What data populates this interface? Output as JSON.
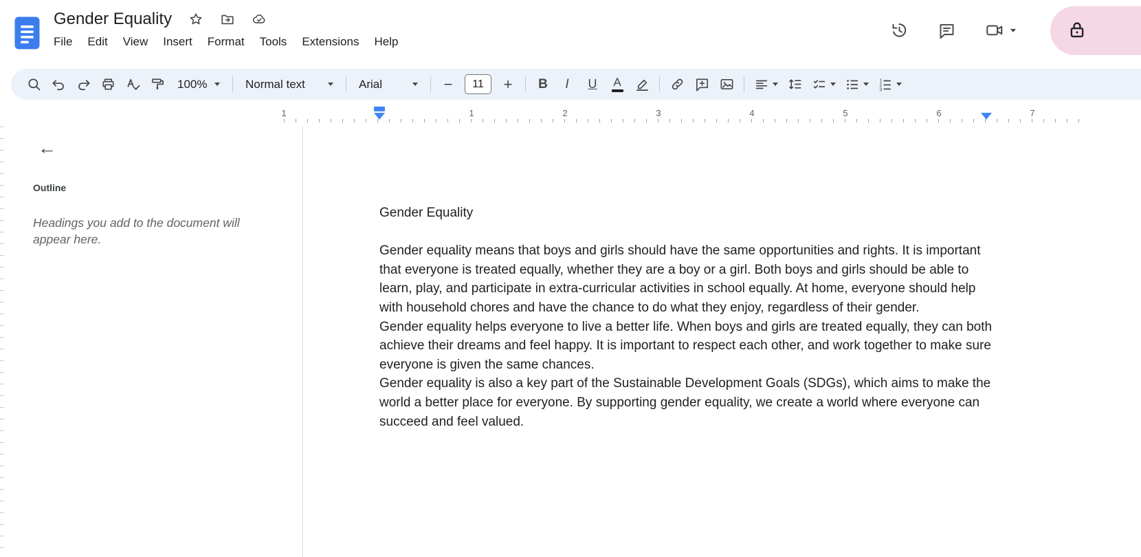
{
  "header": {
    "doc_title": "Gender Equality",
    "menus": [
      "File",
      "Edit",
      "View",
      "Insert",
      "Format",
      "Tools",
      "Extensions",
      "Help"
    ]
  },
  "toolbar": {
    "zoom": "100%",
    "paragraph_style": "Normal text",
    "font": "Arial",
    "font_size": "11",
    "bold_label": "B",
    "italic_label": "I",
    "underline_label": "U",
    "text_color_label": "A",
    "minus_label": "−",
    "plus_label": "+"
  },
  "ruler": {
    "numbers": [
      "1",
      "1",
      "2",
      "3",
      "4",
      "5",
      "6",
      "7"
    ]
  },
  "outline_panel": {
    "back_glyph": "←",
    "title": "Outline",
    "empty_hint": "Headings you add to the document will appear here."
  },
  "document": {
    "title": "Gender Equality",
    "paragraphs": [
      "Gender equality means that boys and girls should have the same opportunities and rights. It is important that everyone is treated equally, whether they are a boy or a girl. Both boys and girls should be able to learn, play, and participate in extra-curricular activities in school equally. At home, everyone should help with household chores and have the chance to do what they enjoy, regardless of their gender.",
      "Gender equality helps everyone to live a better life. When boys and girls are treated equally, they can both achieve their dreams and feel happy. It is important to respect each other, and work together to make sure everyone is given the same chances.",
      "Gender equality is also a key part of the Sustainable Development Goals (SDGs), which aims to make the world a better place for everyone. By supporting gender equality, we create a world where everyone can succeed and feel valued."
    ]
  },
  "icons": {
    "docs_logo": "blue-document-with-white-lines",
    "star": "star-outline",
    "move_folder": "folder-with-arrow",
    "cloud_status": "cloud-with-check",
    "version_history": "clock-with-arrow",
    "open_comments": "speech-bubble",
    "meet_video": "video-camera",
    "share_lock": "padlock",
    "search": "magnifier",
    "undo": "curved-arrow-left",
    "redo": "curved-arrow-right",
    "print": "printer",
    "spellcheck": "a-with-check",
    "paint_format": "paint-roller",
    "highlight": "marker-pen",
    "insert_link": "chain-links",
    "add_comment": "speech-bubble-plus",
    "insert_image": "picture-with-mountain",
    "align": "align-left-lines",
    "line_spacing": "vertical-arrows-with-lines",
    "checklist": "checks-with-lines",
    "bulleted_list": "dots-with-lines",
    "numbered_list": "numbers-with-lines"
  },
  "colors": {
    "toolbar_bg": "#edf2fa",
    "logo_blue": "#3b7ded",
    "icon_gray": "#444746",
    "ruler_marker_blue": "#4285f4",
    "share_pill_pink": "#f5d7e6",
    "hint_gray": "#5f6368",
    "text_color": "#1f1f1f",
    "outline_border": "#dadce0"
  }
}
